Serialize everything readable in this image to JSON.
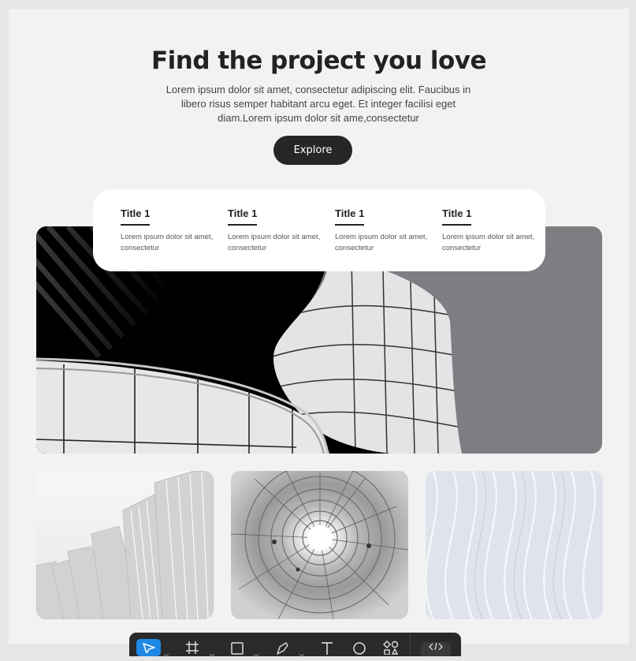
{
  "hero": {
    "title": "Find the project you love",
    "description": "Lorem ipsum dolor sit amet, consectetur adipiscing elit. Faucibus in libero risus semper habitant arcu eget. Et integer facilisi eget diam.Lorem ipsum dolor sit ame,consectetur",
    "explore_label": "Explore"
  },
  "features": [
    {
      "title": "Title 1",
      "description": "Lorem ipsum dolor sit amet, consectetur"
    },
    {
      "title": "Title 1",
      "description": "Lorem ipsum dolor sit amet, consectetur"
    },
    {
      "title": "Title 1",
      "description": "Lorem ipsum dolor sit amet, consectetur"
    },
    {
      "title": "Title 1",
      "description": "Lorem ipsum dolor sit amet, consectetur"
    }
  ],
  "toolbar": {
    "tools": [
      "move-tool-icon",
      "frame-tool-icon",
      "rectangle-tool-icon",
      "pen-tool-icon",
      "text-tool-icon",
      "ellipse-tool-icon",
      "components-tool-icon",
      "code-icon"
    ],
    "active_tool": "move-tool-icon",
    "accent": "#1e88e5"
  }
}
